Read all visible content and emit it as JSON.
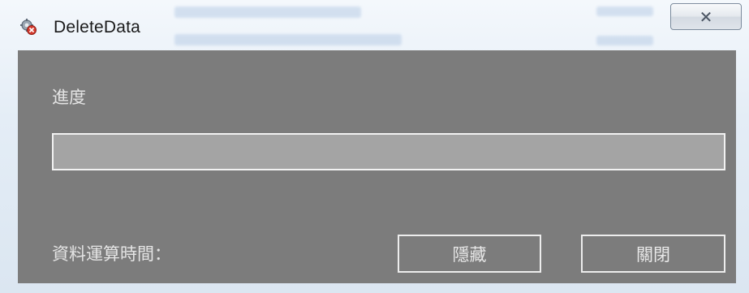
{
  "window": {
    "title": "DeleteData",
    "close_glyph": "✕"
  },
  "dialog": {
    "progress_label": "進度",
    "progress_value": 0,
    "time_label": "資料運算時間：",
    "hide_button": "隱藏",
    "close_button": "關閉"
  },
  "icons": {
    "app": "gear-delete-icon",
    "close": "close-icon"
  },
  "colors": {
    "client_background": "#7c7c7c",
    "progress_track": "#a4a4a4",
    "progress_border": "#f2f2f2",
    "text_light": "#e4e4e4"
  }
}
